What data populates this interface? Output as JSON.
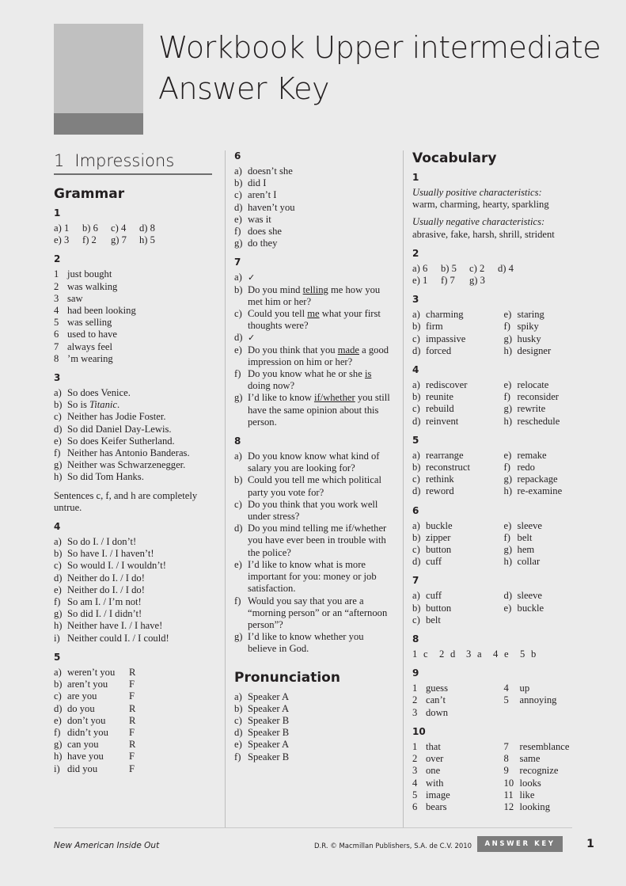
{
  "header": {
    "title_line_1": "Workbook Upper intermediate",
    "title_line_2": "Answer Key",
    "logo_top_color": "#c0c0c0",
    "logo_bottom_color": "#808080"
  },
  "unit": {
    "number": "1",
    "name": "Impressions"
  },
  "sections": {
    "grammar": "Grammar",
    "pronunciation": "Pronunciation",
    "vocabulary": "Vocabulary"
  },
  "grammar": {
    "ex1": {
      "number": "1",
      "rows": [
        [
          {
            "lab": "a)",
            "val": "1"
          },
          {
            "lab": "b)",
            "val": "6"
          },
          {
            "lab": "c)",
            "val": "4"
          },
          {
            "lab": "d)",
            "val": "8"
          }
        ],
        [
          {
            "lab": "e)",
            "val": "3"
          },
          {
            "lab": "f)",
            "val": "2"
          },
          {
            "lab": "g)",
            "val": "7"
          },
          {
            "lab": "h)",
            "val": "5"
          }
        ]
      ]
    },
    "ex2": {
      "number": "2",
      "items": [
        {
          "lab": "1",
          "txt": "just bought"
        },
        {
          "lab": "2",
          "txt": "was walking"
        },
        {
          "lab": "3",
          "txt": "saw"
        },
        {
          "lab": "4",
          "txt": "had been looking"
        },
        {
          "lab": "5",
          "txt": "was selling"
        },
        {
          "lab": "6",
          "txt": "used to have"
        },
        {
          "lab": "7",
          "txt": "always feel"
        },
        {
          "lab": "8",
          "txt": "’m wearing"
        }
      ]
    },
    "ex3": {
      "number": "3",
      "items": [
        {
          "lab": "a)",
          "pre": "So does Venice.",
          "ital": "",
          "post": ""
        },
        {
          "lab": "b)",
          "pre": "So is ",
          "ital": "Titanic",
          "post": "."
        },
        {
          "lab": "c)",
          "pre": "Neither has Jodie Foster.",
          "ital": "",
          "post": ""
        },
        {
          "lab": "d)",
          "pre": "So did Daniel Day-Lewis.",
          "ital": "",
          "post": ""
        },
        {
          "lab": "e)",
          "pre": "So does Keifer Sutherland.",
          "ital": "",
          "post": ""
        },
        {
          "lab": "f)",
          "pre": "Neither has Antonio Banderas.",
          "ital": "",
          "post": ""
        },
        {
          "lab": "g)",
          "pre": "Neither was Schwarzenegger.",
          "ital": "",
          "post": ""
        },
        {
          "lab": "h)",
          "pre": "So did Tom Hanks.",
          "ital": "",
          "post": ""
        }
      ],
      "note": "Sentences c, f, and h are completely untrue."
    },
    "ex4": {
      "number": "4",
      "items": [
        {
          "lab": "a)",
          "txt": "So do I. / I don’t!"
        },
        {
          "lab": "b)",
          "txt": "So have I. / I haven’t!"
        },
        {
          "lab": "c)",
          "txt": "So would I. / I wouldn’t!"
        },
        {
          "lab": "d)",
          "txt": "Neither do I. / I do!"
        },
        {
          "lab": "e)",
          "txt": "Neither do I. / I do!"
        },
        {
          "lab": "f)",
          "txt": "So am I. / I’m not!"
        },
        {
          "lab": "g)",
          "txt": "So did I. / I didn’t!"
        },
        {
          "lab": "h)",
          "txt": "Neither have I. / I have!"
        },
        {
          "lab": "i)",
          "txt": "Neither could I. / I could!"
        }
      ]
    },
    "ex5": {
      "number": "5",
      "items": [
        {
          "lab": "a)",
          "word": "weren’t you",
          "mark": "R"
        },
        {
          "lab": "b)",
          "word": "aren’t you",
          "mark": "F"
        },
        {
          "lab": "c)",
          "word": "are you",
          "mark": "F"
        },
        {
          "lab": "d)",
          "word": "do you",
          "mark": "R"
        },
        {
          "lab": "e)",
          "word": "don’t you",
          "mark": "R"
        },
        {
          "lab": "f)",
          "word": "didn’t you",
          "mark": "F"
        },
        {
          "lab": "g)",
          "word": "can you",
          "mark": "R"
        },
        {
          "lab": "h)",
          "word": "have you",
          "mark": "F"
        },
        {
          "lab": "i)",
          "word": "did you",
          "mark": "F"
        }
      ]
    },
    "ex6": {
      "number": "6",
      "items": [
        {
          "lab": "a)",
          "txt": "doesn’t she"
        },
        {
          "lab": "b)",
          "txt": "did I"
        },
        {
          "lab": "c)",
          "txt": "aren’t I"
        },
        {
          "lab": "d)",
          "txt": "haven’t you"
        },
        {
          "lab": "e)",
          "txt": "was it"
        },
        {
          "lab": "f)",
          "txt": "does she"
        },
        {
          "lab": "g)",
          "txt": "do they"
        }
      ]
    },
    "ex7": {
      "number": "7",
      "items": [
        {
          "lab": "a)",
          "pre": "✓",
          "und": "",
          "post": "",
          "check": true
        },
        {
          "lab": "b)",
          "pre": "Do you mind ",
          "und": "telling",
          "post": " me how you met him or her?",
          "check": false
        },
        {
          "lab": "c)",
          "pre": "Could you tell ",
          "und": "me",
          "post": " what your first thoughts were?",
          "check": false
        },
        {
          "lab": "d)",
          "pre": "✓",
          "und": "",
          "post": "",
          "check": true
        },
        {
          "lab": "e)",
          "pre": "Do you think that you ",
          "und": "made",
          "post": " a good impression on him or her?",
          "check": false
        },
        {
          "lab": "f)",
          "pre": "Do you know what he or she ",
          "und": "is",
          "post": " doing now?",
          "check": false
        },
        {
          "lab": "g)",
          "pre": "I’d like to know ",
          "und": "if/whether",
          "post": " you still have the same opinion about this person.",
          "check": false
        }
      ]
    },
    "ex8": {
      "number": "8",
      "items": [
        {
          "lab": "a)",
          "txt": "Do you know know what kind of salary you are looking for?"
        },
        {
          "lab": "b)",
          "txt": "Could you tell me which political party you vote for?"
        },
        {
          "lab": "c)",
          "txt": "Do you think that you work well under stress?"
        },
        {
          "lab": "d)",
          "txt": "Do you mind telling me if/whether you have ever been in trouble with the police?"
        },
        {
          "lab": "e)",
          "txt": "I’d like to know what is more important for you: money or job satisfaction."
        },
        {
          "lab": "f)",
          "txt": "Would you say that you are a “morning person” or an “afternoon person”?"
        },
        {
          "lab": "g)",
          "txt": "I’d like to know whether you believe in God."
        }
      ]
    }
  },
  "pronunciation": {
    "items": [
      {
        "lab": "a)",
        "txt": "Speaker A"
      },
      {
        "lab": "b)",
        "txt": "Speaker A"
      },
      {
        "lab": "c)",
        "txt": "Speaker B"
      },
      {
        "lab": "d)",
        "txt": "Speaker B"
      },
      {
        "lab": "e)",
        "txt": "Speaker A"
      },
      {
        "lab": "f)",
        "txt": "Speaker B"
      }
    ]
  },
  "vocabulary": {
    "ex1": {
      "number": "1",
      "positive_label": "Usually positive characteristics:",
      "positive_words": "warm, charming, hearty, sparkling",
      "negative_label": "Usually negative characteristics:",
      "negative_words": "abrasive, fake, harsh, shrill, strident"
    },
    "ex2": {
      "number": "2",
      "rows": [
        [
          {
            "lab": "a)",
            "val": "6"
          },
          {
            "lab": "b)",
            "val": "5"
          },
          {
            "lab": "c)",
            "val": "2"
          },
          {
            "lab": "d)",
            "val": "4"
          }
        ],
        [
          {
            "lab": "e)",
            "val": "1"
          },
          {
            "lab": "f)",
            "val": "7"
          },
          {
            "lab": "g)",
            "val": "3"
          }
        ]
      ]
    },
    "ex3": {
      "number": "3",
      "left": [
        {
          "lab": "a)",
          "txt": "charming"
        },
        {
          "lab": "b)",
          "txt": "firm"
        },
        {
          "lab": "c)",
          "txt": "impassive"
        },
        {
          "lab": "d)",
          "txt": "forced"
        }
      ],
      "right": [
        {
          "lab": "e)",
          "txt": "staring"
        },
        {
          "lab": "f)",
          "txt": "spiky"
        },
        {
          "lab": "g)",
          "txt": "husky"
        },
        {
          "lab": "h)",
          "txt": "designer"
        }
      ]
    },
    "ex4": {
      "number": "4",
      "left": [
        {
          "lab": "a)",
          "txt": "rediscover"
        },
        {
          "lab": "b)",
          "txt": "reunite"
        },
        {
          "lab": "c)",
          "txt": "rebuild"
        },
        {
          "lab": "d)",
          "txt": "reinvent"
        }
      ],
      "right": [
        {
          "lab": "e)",
          "txt": "relocate"
        },
        {
          "lab": "f)",
          "txt": "reconsider"
        },
        {
          "lab": "g)",
          "txt": "rewrite"
        },
        {
          "lab": "h)",
          "txt": "reschedule"
        }
      ]
    },
    "ex5": {
      "number": "5",
      "left": [
        {
          "lab": "a)",
          "txt": "rearrange"
        },
        {
          "lab": "b)",
          "txt": "reconstruct"
        },
        {
          "lab": "c)",
          "txt": "rethink"
        },
        {
          "lab": "d)",
          "txt": "reword"
        }
      ],
      "right": [
        {
          "lab": "e)",
          "txt": "remake"
        },
        {
          "lab": "f)",
          "txt": "redo"
        },
        {
          "lab": "g)",
          "txt": "repackage"
        },
        {
          "lab": "h)",
          "txt": "re-examine"
        }
      ]
    },
    "ex6": {
      "number": "6",
      "left": [
        {
          "lab": "a)",
          "txt": "buckle"
        },
        {
          "lab": "b)",
          "txt": "zipper"
        },
        {
          "lab": "c)",
          "txt": "button"
        },
        {
          "lab": "d)",
          "txt": "cuff"
        }
      ],
      "right": [
        {
          "lab": "e)",
          "txt": "sleeve"
        },
        {
          "lab": "f)",
          "txt": "belt"
        },
        {
          "lab": "g)",
          "txt": "hem"
        },
        {
          "lab": "h)",
          "txt": "collar"
        }
      ]
    },
    "ex7": {
      "number": "7",
      "left": [
        {
          "lab": "a)",
          "txt": "cuff"
        },
        {
          "lab": "b)",
          "txt": "button"
        },
        {
          "lab": "c)",
          "txt": "belt"
        }
      ],
      "right": [
        {
          "lab": "d)",
          "txt": "sleeve"
        },
        {
          "lab": "e)",
          "txt": "buckle"
        }
      ]
    },
    "ex8": {
      "number": "8",
      "pairs": [
        {
          "n": "1",
          "v": "c"
        },
        {
          "n": "2",
          "v": "d"
        },
        {
          "n": "3",
          "v": "a"
        },
        {
          "n": "4",
          "v": "e"
        },
        {
          "n": "5",
          "v": "b"
        }
      ]
    },
    "ex9": {
      "number": "9",
      "left": [
        {
          "lab": "1",
          "txt": "guess"
        },
        {
          "lab": "2",
          "txt": "can’t"
        },
        {
          "lab": "3",
          "txt": "down"
        }
      ],
      "right": [
        {
          "lab": "4",
          "txt": "up"
        },
        {
          "lab": "5",
          "txt": "annoying"
        }
      ]
    },
    "ex10": {
      "number": "10",
      "left": [
        {
          "lab": "1",
          "txt": "that"
        },
        {
          "lab": "2",
          "txt": "over"
        },
        {
          "lab": "3",
          "txt": "one"
        },
        {
          "lab": "4",
          "txt": "with"
        },
        {
          "lab": "5",
          "txt": "image"
        },
        {
          "lab": "6",
          "txt": "bears"
        }
      ],
      "right": [
        {
          "lab": "7",
          "txt": "resemblance"
        },
        {
          "lab": "8",
          "txt": "same"
        },
        {
          "lab": "9",
          "txt": "recognize"
        },
        {
          "lab": "10",
          "txt": "looks"
        },
        {
          "lab": "11",
          "txt": "like"
        },
        {
          "lab": "12",
          "txt": "looking"
        }
      ]
    }
  },
  "footer": {
    "series_title": "New American Inside Out",
    "copyright": "D.R. © Macmillan Publishers, S.A. de C.V. 2010",
    "tab_label": "ANSWER KEY",
    "page_number": "1"
  }
}
